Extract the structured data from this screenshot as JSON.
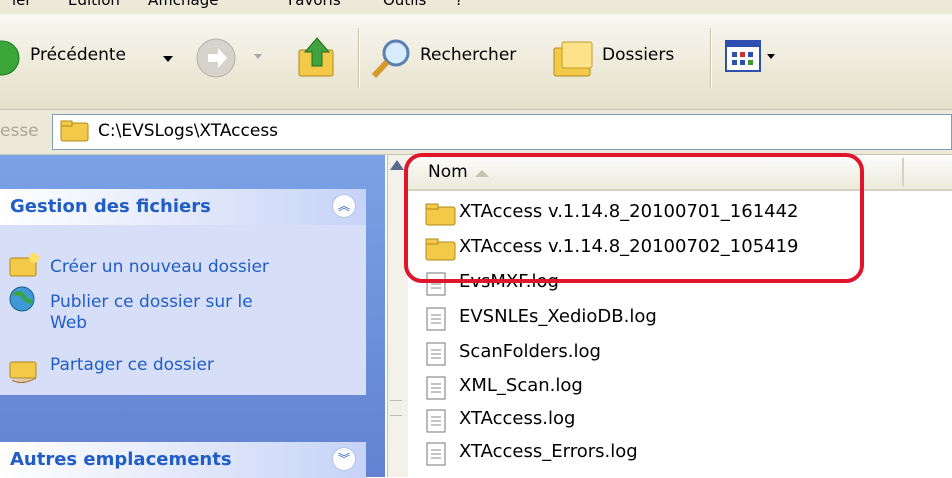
{
  "menu": {
    "items": [
      "ier",
      "Edition",
      "Affichage",
      "Favoris",
      "Outils",
      "?"
    ]
  },
  "toolbar": {
    "back_label": "Précédente",
    "search_label": "Rechercher",
    "folders_label": "Dossiers"
  },
  "address": {
    "label": "esse",
    "path": "C:\\EVSLogs\\XTAccess"
  },
  "tasks_panel": {
    "title": "Gestion des fichiers",
    "items": [
      {
        "label": "Créer un nouveau dossier",
        "icon": "new-folder-icon"
      },
      {
        "label": "Publier ce dossier sur le Web",
        "icon": "publish-web-icon"
      },
      {
        "label": "Partager ce dossier",
        "icon": "share-folder-icon"
      }
    ]
  },
  "places_panel": {
    "title": "Autres emplacements"
  },
  "file_list": {
    "column_name": "Nom",
    "rows": [
      {
        "name": "XTAccess v.1.14.8_20100701_161442",
        "type": "folder"
      },
      {
        "name": "XTAccess v.1.14.8_20100702_105419",
        "type": "folder"
      },
      {
        "name": "EvsMXF.log",
        "type": "log"
      },
      {
        "name": "EVSNLEs_XedioDB.log",
        "type": "log"
      },
      {
        "name": "ScanFolders.log",
        "type": "log"
      },
      {
        "name": "XML_Scan.log",
        "type": "log"
      },
      {
        "name": "XTAccess.log",
        "type": "log"
      },
      {
        "name": "XTAccess_Errors.log",
        "type": "log"
      }
    ]
  },
  "colors": {
    "highlight": "#e0142b",
    "task_link": "#215dc6",
    "panel_bg": "#6b8fd8"
  }
}
